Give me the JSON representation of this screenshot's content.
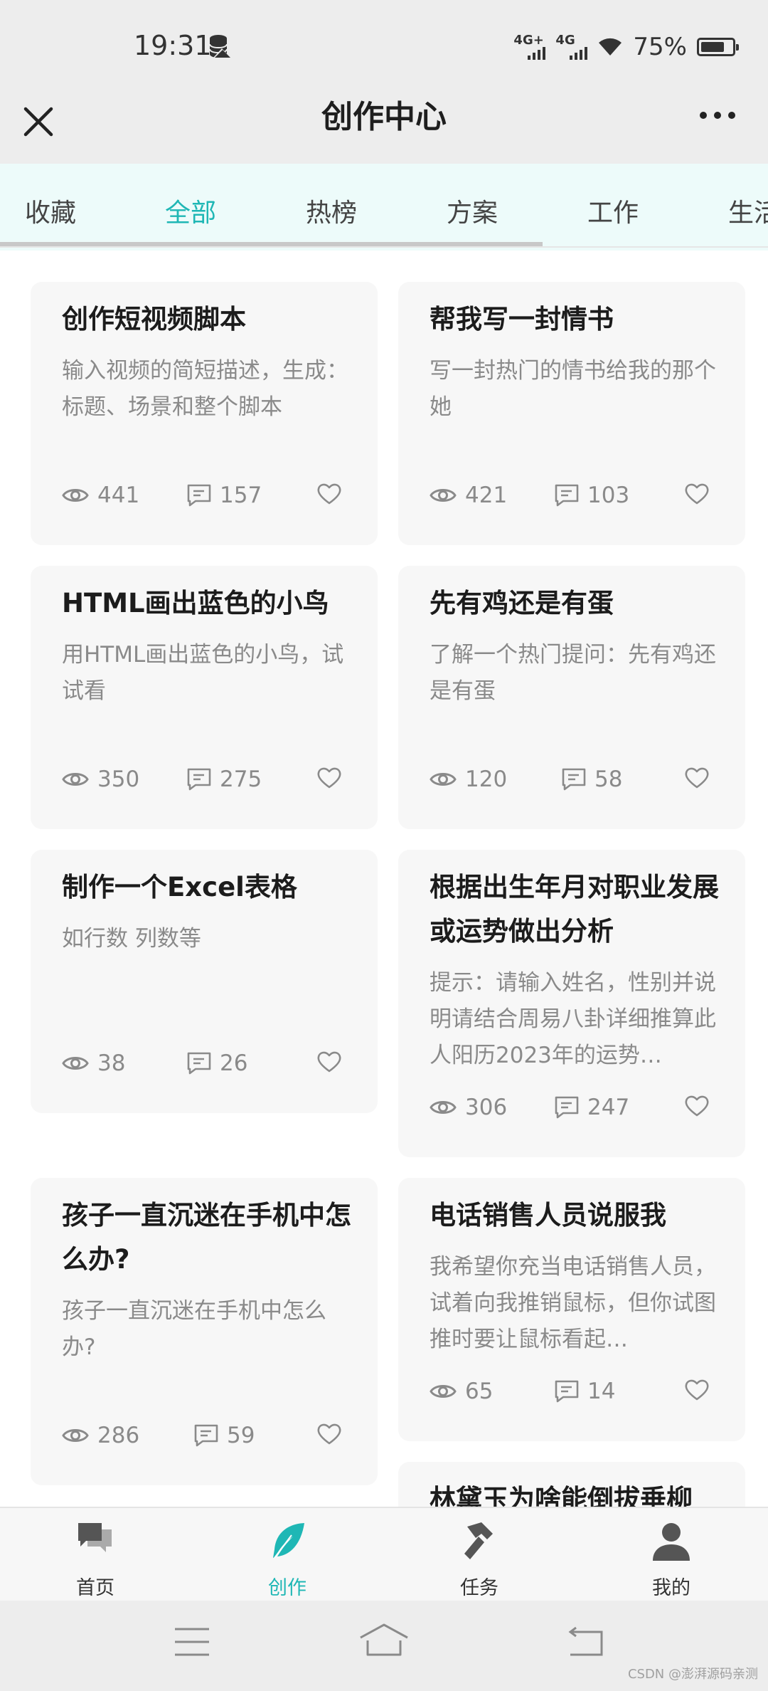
{
  "status_bar": {
    "time": "19:31",
    "signal1": "4G+",
    "signal2": "4G",
    "battery": "75%",
    "battery_level": 0.75
  },
  "header": {
    "title": "创作中心"
  },
  "tabs": [
    {
      "label": "收藏"
    },
    {
      "label": "全部",
      "active": true
    },
    {
      "label": "热榜"
    },
    {
      "label": "方案"
    },
    {
      "label": "工作"
    },
    {
      "label": "生活"
    }
  ],
  "cards": [
    {
      "title": "创作短视频脚本",
      "desc": "输入视频的简短描述，生成：标题、场景和整个脚本",
      "views": "441",
      "comments": "157"
    },
    {
      "title": "帮我写一封情书",
      "desc": "写一封热门的情书给我的那个她",
      "views": "421",
      "comments": "103"
    },
    {
      "title": "HTML画出蓝色的小鸟",
      "desc": "用HTML画出蓝色的小鸟，试试看",
      "views": "350",
      "comments": "275"
    },
    {
      "title": "先有鸡还是有蛋",
      "desc": "了解一个热门提问：先有鸡还是有蛋",
      "views": "120",
      "comments": "58"
    },
    {
      "title": "制作一个Excel表格",
      "desc": "如行数 列数等",
      "views": "38",
      "comments": "26"
    },
    {
      "title": "根据出生年月对职业发展或运势做出分析",
      "desc": "提示：请输入姓名，性别并说明请结合周易八卦详细推算此人阳历2023年的运势…",
      "views": "306",
      "comments": "247"
    },
    {
      "title": "孩子一直沉迷在手机中怎么办?",
      "desc": "孩子一直沉迷在手机中怎么办?",
      "views": "286",
      "comments": "59"
    },
    {
      "title": "电话销售人员说服我",
      "desc": "我希望你充当电话销售人员，试着向我推销鼠标，但你试图推时要让鼠标看起…",
      "views": "65",
      "comments": "14"
    },
    {
      "title": "林黛玉为啥能倒拔垂柳",
      "desc": "",
      "views": "",
      "comments": ""
    }
  ],
  "bottom_nav": [
    {
      "label": "首页",
      "icon": "chat-icon"
    },
    {
      "label": "创作",
      "icon": "feather-icon",
      "active": true
    },
    {
      "label": "任务",
      "icon": "hammer-icon"
    },
    {
      "label": "我的",
      "icon": "user-icon"
    }
  ],
  "watermark": "CSDN @澎湃源码亲测",
  "colors": {
    "accent": "#1fb7b5",
    "tab_bg": "#edfbfa",
    "card_bg": "#f7f7f7"
  }
}
